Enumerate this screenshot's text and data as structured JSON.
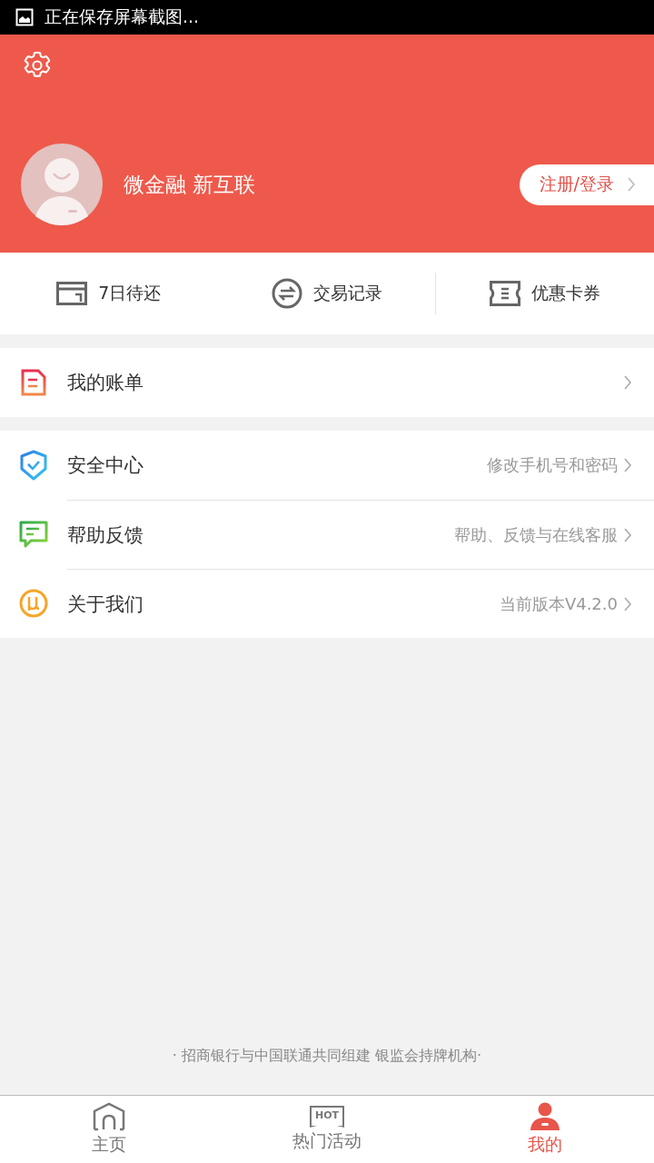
{
  "status_bar": {
    "notification": "正在保存屏幕截图..."
  },
  "profile": {
    "name": "微金融 新互联",
    "login_button": "注册/登录"
  },
  "quick_actions": [
    {
      "kind": "calendar",
      "label": "7日待还",
      "divider": false
    },
    {
      "kind": "exchange",
      "label": "交易记录",
      "divider": false
    },
    {
      "kind": "ticket",
      "label": "优惠卡券",
      "divider": true
    }
  ],
  "menu_groups": [
    [
      {
        "kind": "bill",
        "label": "我的账单"
      }
    ],
    [
      {
        "kind": "shield",
        "label": "安全中心",
        "detail": "修改手机号和密码"
      },
      {
        "kind": "chat",
        "label": "帮助反馈",
        "detail": "帮助、反馈与在线客服"
      },
      {
        "kind": "about",
        "label": "关于我们",
        "detail": "当前版本V4.2.0"
      }
    ]
  ],
  "footer_note": "· 招商银行与中国联通共同组建 银监会持牌机构·",
  "tabs": [
    {
      "kind": "home",
      "label": "主页",
      "selected": false
    },
    {
      "kind": "hot",
      "label": "热门活动",
      "icon_text": "HOT",
      "selected": false
    },
    {
      "kind": "person",
      "label": "我的",
      "selected": true
    }
  ]
}
